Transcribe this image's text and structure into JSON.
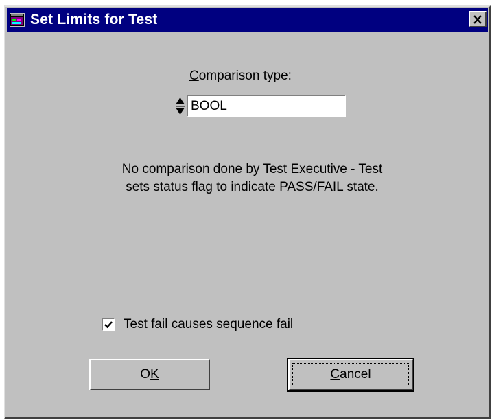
{
  "window": {
    "title": "Set Limits for Test",
    "icon": "app-window-icon",
    "close_icon": "close-icon",
    "title_bar_color": "#000080",
    "face_color": "#c0c0c0"
  },
  "comparison": {
    "label_mnemonic": "C",
    "label_rest": "omparison type:",
    "value": "BOOL",
    "spinner_icon": "up-down-spinner-icon"
  },
  "info": {
    "line1": "No comparison done by Test Executive - Test",
    "line2": "sets status flag to indicate PASS/FAIL state."
  },
  "options": {
    "fail_sequence_label": "Test fail causes sequence fail",
    "fail_sequence_checked": true
  },
  "buttons": {
    "ok_prefix": "O",
    "ok_mnemonic": "K",
    "cancel_mnemonic": "C",
    "cancel_rest": "ancel"
  }
}
